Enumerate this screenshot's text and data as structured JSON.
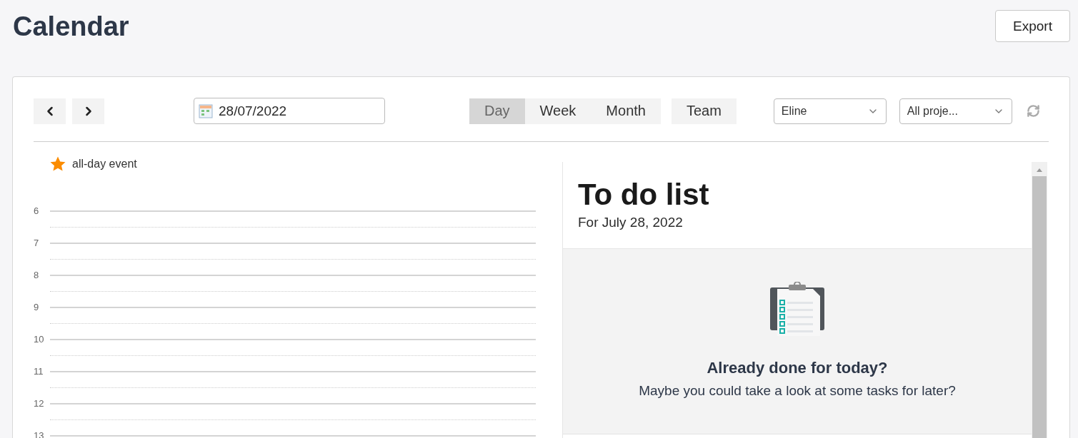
{
  "page": {
    "title": "Calendar",
    "export_label": "Export"
  },
  "toolbar": {
    "date": "28/07/2022",
    "views": [
      {
        "label": "Day",
        "selected": true
      },
      {
        "label": "Week",
        "selected": false
      },
      {
        "label": "Month",
        "selected": false
      }
    ],
    "team": {
      "label": "Team",
      "selected": false
    },
    "person": "Eline",
    "projects": "All proje..."
  },
  "all_day": {
    "label": "all-day event"
  },
  "hours": [
    "6",
    "7",
    "8",
    "9",
    "10",
    "11",
    "12",
    "13"
  ],
  "todo": {
    "title": "To do list",
    "subtitle": "For July 28, 2022",
    "empty_title": "Already done for today?",
    "empty_text": "Maybe you could take a look at some tasks for later?"
  }
}
